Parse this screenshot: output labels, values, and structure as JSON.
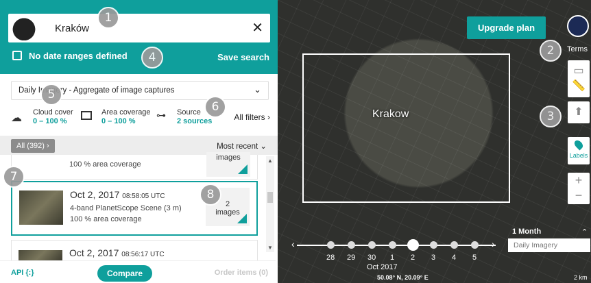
{
  "search": {
    "location": "Kraków"
  },
  "dates": {
    "label": "No date ranges defined",
    "save_label": "Save search"
  },
  "mode": {
    "selected": "Daily Imagery - Aggregate of image captures"
  },
  "filters": {
    "cloud": {
      "label": "Cloud cover",
      "value": "0 – 100 %"
    },
    "area": {
      "label": "Area coverage",
      "value": "0 – 100 %"
    },
    "source": {
      "label": "Source",
      "value": "2 sources"
    },
    "all_label": "All filters"
  },
  "list": {
    "all_label": "All (392)",
    "sort_label": "Most recent",
    "items": [
      {
        "date": "",
        "time": "",
        "desc": "",
        "coverage": "100 % area coverage",
        "count": "images"
      },
      {
        "date": "Oct 2, 2017",
        "time": "08:58:05 UTC",
        "desc": "4-band PlanetScope Scene (3 m)",
        "coverage": "100 % area coverage",
        "count_num": "2",
        "count": "images"
      },
      {
        "date": "Oct 2, 2017",
        "time": "08:56:17 UTC"
      }
    ]
  },
  "footer": {
    "api": "API {:}",
    "compare": "Compare",
    "order": "Order items (0)"
  },
  "map": {
    "upgrade": "Upgrade plan",
    "city": "Krakow",
    "terms": "Terms",
    "labels": "Labels",
    "timeline": {
      "days": [
        "28",
        "29",
        "30",
        "1",
        "2",
        "3",
        "4",
        "5"
      ],
      "month": "Oct 2017",
      "range": "1 Month",
      "imagery": "Daily Imagery"
    },
    "coords": "50.08° N, 20.09° E",
    "scale": "2 km"
  },
  "badges": [
    "1",
    "2",
    "3",
    "4",
    "5",
    "6",
    "7",
    "8"
  ],
  "colors": {
    "accent": "#0f9f9c"
  }
}
